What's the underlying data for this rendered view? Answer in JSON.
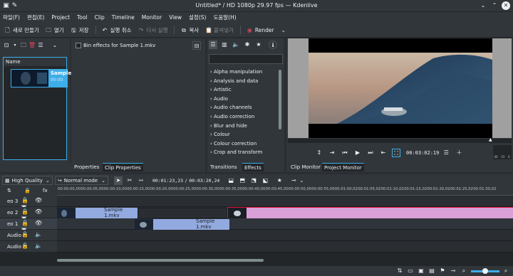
{
  "window": {
    "title": "Untitled* / HD 1080p 29.97 fps — Kdenlive"
  },
  "menu": [
    "파일(F)",
    "편집(E)",
    "Project",
    "Tool",
    "Clip",
    "Timeline",
    "Monitor",
    "View",
    "설정(S)",
    "도움말(H)"
  ],
  "toolbar": {
    "new_label": "새로 만들기",
    "open_label": "열기",
    "save_label": "저장",
    "undo_label": "실행 취소",
    "redo_label": "다시 실행",
    "copy_label": "복사",
    "paste_label": "붙여넣기",
    "render_label": "Render"
  },
  "bin": {
    "column_name": "Name",
    "clip_name": "Sample",
    "clip_duration": "00:00",
    "checkbox_label": "Bin effects for Sample 1.mkv"
  },
  "left_tabs": [
    "Properties",
    "Clip Properties"
  ],
  "effects": {
    "search_placeholder": "",
    "categories": [
      "Alpha manipulation",
      "Analysis and data",
      "Artistic",
      "Audio",
      "Audio channels",
      "Audio correction",
      "Blur and hide",
      "Colour",
      "Colour correction",
      "Crop and transform"
    ],
    "tabs": [
      "Transitions",
      "Effects"
    ]
  },
  "monitor": {
    "timecode": "00:03:02:19",
    "audio_scale": [
      "-30",
      "-15",
      "0"
    ],
    "tabs": [
      "Clip Monitor",
      "Project Monitor"
    ]
  },
  "timeline_toolbar": {
    "quality": "High Quality",
    "mode": "Normal mode",
    "position": "00:01:23,23",
    "duration": "00:03:20,24"
  },
  "ruler": [
    "00:00:00,00",
    "00:00:05,00",
    "00:00:10,00",
    "00:00:15,00",
    "00:00:20,00",
    "00:00:25,00",
    "00:00:30,00",
    "00:00:35,00",
    "00:00:40,00",
    "00:00:45,00",
    "00:00:50,00",
    "00:00:55,00",
    "00:01:00,02",
    "00:01:05,02",
    "00:01:10,02",
    "00:01:15,02",
    "00:01:20,02",
    "00:01:25,02",
    "00:01:30,02"
  ],
  "tracks": [
    {
      "name": "eo 3",
      "clip": ""
    },
    {
      "name": "eo 2",
      "clip": "Sample 1.mkv"
    },
    {
      "name": "eo 1",
      "clip": "Sample 1.mkv"
    },
    {
      "name": "Audio 1",
      "clip": ""
    },
    {
      "name": "Audio 2",
      "clip": ""
    }
  ],
  "colors": {
    "accent": "#3daee9",
    "video_clip": "#93aae0",
    "selected_clip": "#d9a0d8",
    "playhead": "#dc143c"
  }
}
